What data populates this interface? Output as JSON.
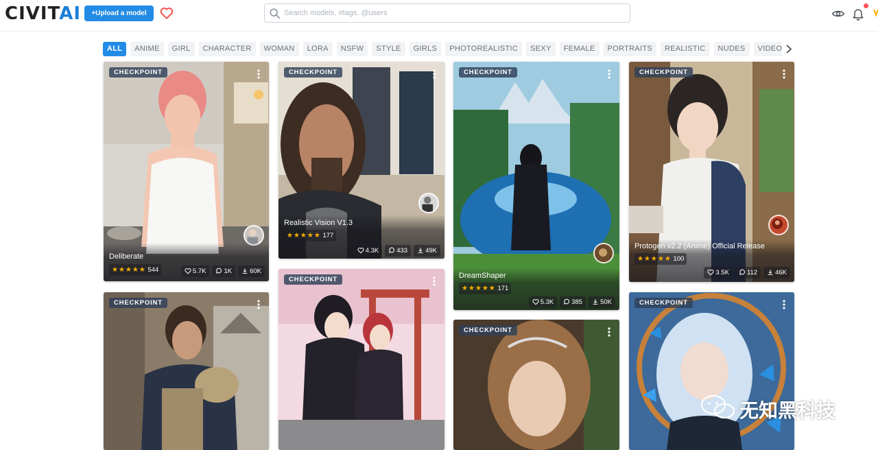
{
  "header": {
    "logo_part1": "CIVIT",
    "logo_part2": "AI",
    "upload_label": "+Upload a model",
    "search_placeholder": "Search models, #tags, @users"
  },
  "tags": [
    "ALL",
    "ANIME",
    "GIRL",
    "CHARACTER",
    "WOMAN",
    "LORA",
    "NSFW",
    "STYLE",
    "GIRLS",
    "PHOTOREALISTIC",
    "SEXY",
    "FEMALE",
    "PORTRAITS",
    "REALISTIC",
    "NUDES",
    "VIDEO"
  ],
  "active_tag": "ALL",
  "cards": [
    {
      "badge": "CHECKPOINT",
      "name": "Deliberate",
      "stars": "★★★★★",
      "rating_count": "544",
      "likes": "5.7K",
      "comments": "1K",
      "downloads": "60K"
    },
    {
      "badge": "CHECKPOINT",
      "name": "Realistic Vision V1.3",
      "stars": "★★★★★",
      "rating_count": "177",
      "likes": "4.3K",
      "comments": "433",
      "downloads": "49K"
    },
    {
      "badge": "CHECKPOINT",
      "name": "DreamShaper",
      "stars": "★★★★★",
      "rating_count": "171",
      "likes": "5.3K",
      "comments": "385",
      "downloads": "50K"
    },
    {
      "badge": "CHECKPOINT",
      "name": "Protogen v2.2 (Anime) Official Release",
      "stars": "★★★★★",
      "rating_count": "100",
      "likes": "3.5K",
      "comments": "112",
      "downloads": "46K"
    },
    {
      "badge": "CHECKPOINT"
    },
    {
      "badge": "CHECKPOINT"
    },
    {
      "badge": "CHECKPOINT"
    },
    {
      "badge": "CHECKPOINT"
    }
  ],
  "watermark": "无知黑科技",
  "colors": {
    "accent": "#228be6",
    "brand_blue": "#1c7ed6",
    "heart": "#fa5252",
    "star": "#fab005",
    "notification": "#fa5252"
  },
  "icons": [
    "search-icon",
    "heart-icon",
    "eye-icon",
    "bell-icon",
    "chevron-right-icon",
    "dots-vertical-icon",
    "like-icon",
    "comment-icon",
    "download-icon"
  ]
}
